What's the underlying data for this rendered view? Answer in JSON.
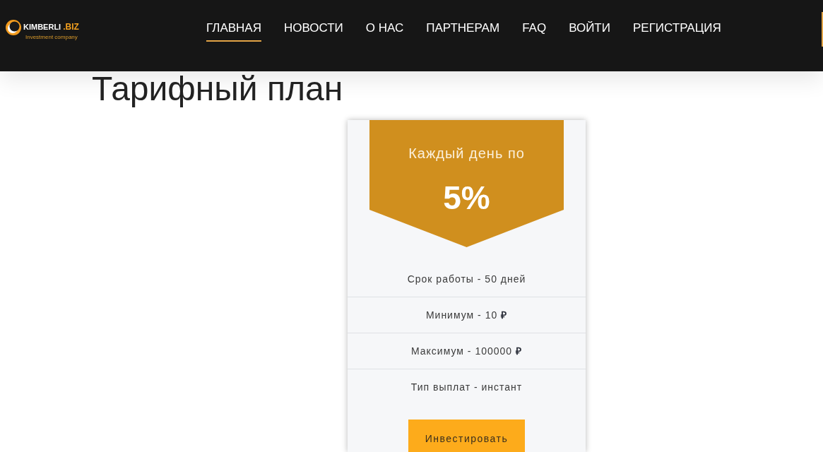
{
  "header": {
    "logo": {
      "name": "KIMBERLI",
      "domain": ".BIZ",
      "tagline": "Investment company"
    },
    "nav": [
      {
        "label": "ГЛАВНАЯ",
        "selected": true
      },
      {
        "label": "НОВОСТИ",
        "selected": false
      },
      {
        "label": "О НАС",
        "selected": false
      },
      {
        "label": "ПАРТНЕРАМ",
        "selected": false
      },
      {
        "label": "FAQ",
        "selected": false
      },
      {
        "label": "ВОЙТИ",
        "selected": false
      },
      {
        "label": "РЕГИСТРАЦИЯ",
        "selected": false
      }
    ]
  },
  "page_title": "Тарифный план",
  "plan": {
    "intro": "Каждый день по",
    "rate": "5%",
    "features": [
      "Срок работы - 50 дней",
      "Минимум - 10 **₽**",
      "Максимум - 100000 **₽**",
      "Тип выплат - инстант"
    ],
    "button": "Инвестировать"
  }
}
